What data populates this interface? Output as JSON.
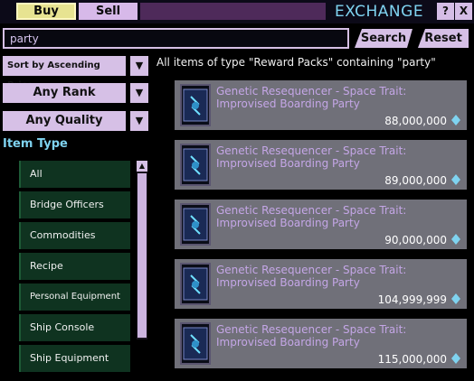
{
  "tabs": {
    "buy": "Buy",
    "sell": "Sell"
  },
  "window": {
    "title": "EXCHANGE",
    "help": "?",
    "close": "X"
  },
  "search": {
    "value": "party",
    "search_label": "Search",
    "reset_label": "Reset"
  },
  "filters": {
    "sort": "Sort by Ascending Price",
    "rank": "Any Rank",
    "quality": "Any Quality",
    "arrow": "▼"
  },
  "item_type": {
    "heading": "Item Type",
    "items": [
      "All",
      "Bridge Officers",
      "Commodities",
      "Recipe",
      "Personal Equipment",
      "Ship Console",
      "Ship Equipment"
    ]
  },
  "results": {
    "summary": "All items of type \"Reward Packs\" containing \"party\"",
    "items": [
      {
        "name": "Genetic Resequencer - Space Trait: Improvised Boarding Party",
        "price": "88,000,000"
      },
      {
        "name": "Genetic Resequencer - Space Trait: Improvised Boarding Party",
        "price": "89,000,000"
      },
      {
        "name": "Genetic Resequencer - Space Trait: Improvised Boarding Party",
        "price": "90,000,000"
      },
      {
        "name": "Genetic Resequencer - Space Trait: Improvised Boarding Party",
        "price": "104,999,999"
      },
      {
        "name": "Genetic Resequencer - Space Trait: Improvised Boarding Party",
        "price": "115,000,000"
      }
    ]
  },
  "colors": {
    "accent_title": "#7fd3f0",
    "button_lavender": "#d6c0e6",
    "buy_tab": "#e7e391",
    "item_type_bg": "#0f3320",
    "result_row_bg": "#707079",
    "item_name": "#c4a6e6"
  },
  "icons": {
    "currency": "dilithium-icon",
    "item": "reward-pack-icon"
  }
}
